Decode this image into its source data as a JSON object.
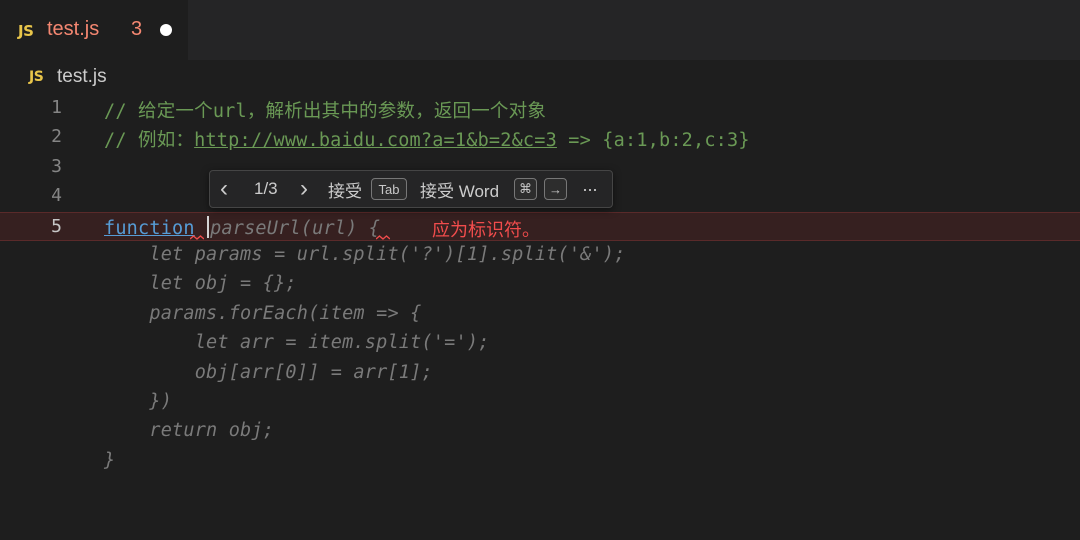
{
  "tab": {
    "icon": "JS",
    "name": "test.js",
    "problems": "3"
  },
  "breadcrumb": {
    "icon": "JS",
    "file": "test.js"
  },
  "lines": [
    {
      "number": "1",
      "comment": "// 给定一个url，解析出其中的参数，返回一个对象"
    },
    {
      "number": "2",
      "comment_prefix": "// 例如：",
      "url": "http://www.baidu.com?a=1&b=2&c=3",
      "comment_suffix": " => {a:1,b:2,c:3}"
    },
    {
      "number": "3"
    },
    {
      "number": "4"
    },
    {
      "number": "5",
      "keyword": "function",
      "ghost": "parseUrl(url) {",
      "error": "应为标识符。"
    },
    {
      "ghost": "    let params = url.split('?')[1].split('&');"
    },
    {
      "ghost": "    let obj = {};"
    },
    {
      "ghost": "    params.forEach(item => {"
    },
    {
      "ghost": "        let arr = item.split('=');"
    },
    {
      "ghost": "        obj[arr[0]] = arr[1];"
    },
    {
      "ghost": "    })"
    },
    {
      "ghost": "    return obj;"
    },
    {
      "ghost": "}"
    }
  ],
  "suggestion_widget": {
    "prev_icon": "‹",
    "counter": "1/3",
    "next_icon": "›",
    "accept_label": "接受",
    "accept_key": "Tab",
    "accept_word_label": "接受 Word",
    "accept_word_key1": "⌘",
    "accept_word_key2": "→",
    "more_icon": "···"
  },
  "colors": {
    "background": "#1e1e1e",
    "tab_error": "#f48771",
    "comment": "#6a9955",
    "keyword": "#569cd6",
    "error": "#f14c4c",
    "js_icon": "#e8c54a"
  }
}
